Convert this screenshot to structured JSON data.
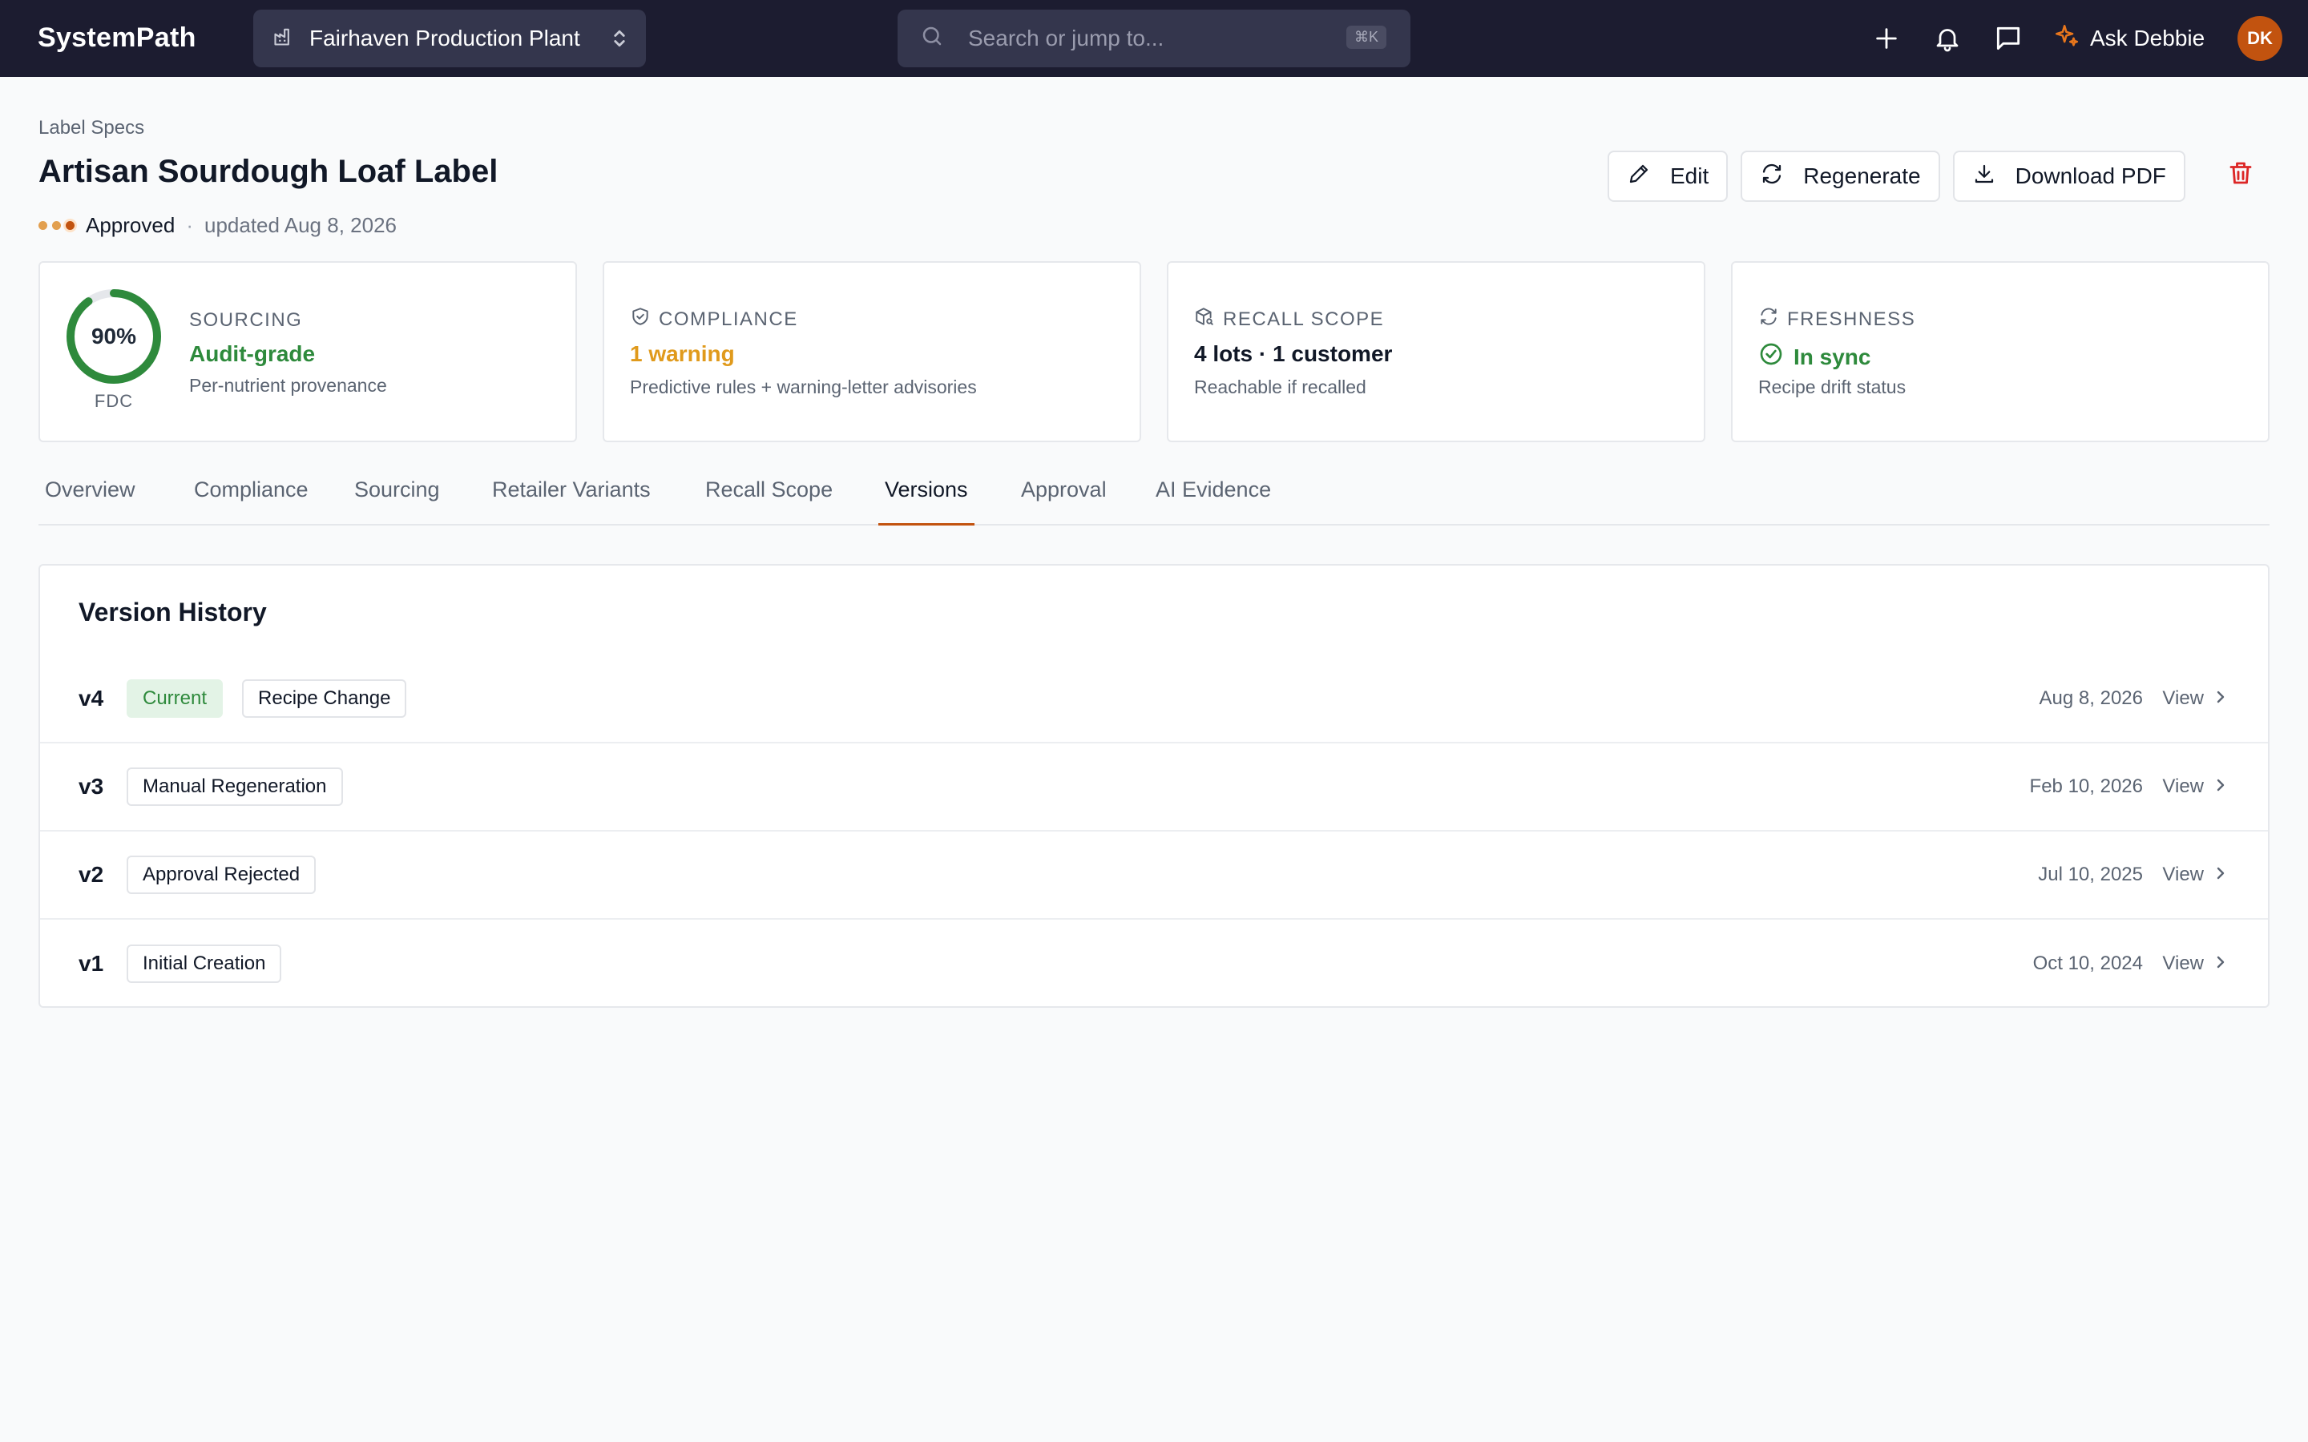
{
  "topbar": {
    "brand": "SystemPath",
    "plant": "Fairhaven Production Plant",
    "search_placeholder": "Search or jump to...",
    "search_shortcut": "⌘K",
    "ask_label": "Ask Debbie",
    "avatar_initials": "DK"
  },
  "header": {
    "breadcrumb": "Label Specs",
    "title": "Artisan Sourdough Loaf Label",
    "status": "Approved",
    "separator": "·",
    "updated": "updated Aug 8, 2026",
    "edit_label": "Edit",
    "regenerate_label": "Regenerate",
    "download_label": "Download PDF"
  },
  "cards": {
    "sourcing": {
      "percent": "90%",
      "percent_value": 0.9,
      "ring_label": "FDC",
      "label": "SOURCING",
      "value": "Audit-grade",
      "sub": "Per-nutrient provenance"
    },
    "compliance": {
      "label": "COMPLIANCE",
      "value": "1 warning",
      "sub": "Predictive rules + warning-letter advisories"
    },
    "recall": {
      "label": "RECALL SCOPE",
      "value": "4 lots · 1 customer",
      "sub": "Reachable if recalled"
    },
    "freshness": {
      "label": "FRESHNESS",
      "value": "In sync",
      "sub": "Recipe drift status"
    }
  },
  "tabs": [
    {
      "label": "Overview"
    },
    {
      "label": "Compliance"
    },
    {
      "label": "Sourcing"
    },
    {
      "label": "Retailer Variants"
    },
    {
      "label": "Recall Scope"
    },
    {
      "label": "Versions"
    },
    {
      "label": "Approval"
    },
    {
      "label": "AI Evidence"
    }
  ],
  "active_tab": "Versions",
  "versions": {
    "title": "Version History",
    "view_label": "View",
    "rows": [
      {
        "version": "v4",
        "current": "Current",
        "reason": "Recipe Change",
        "date": "Aug 8, 2026"
      },
      {
        "version": "v3",
        "reason": "Manual Regeneration",
        "date": "Feb 10, 2026"
      },
      {
        "version": "v2",
        "reason": "Approval Rejected",
        "date": "Jul 10, 2025"
      },
      {
        "version": "v1",
        "reason": "Initial Creation",
        "date": "Oct 10, 2024"
      }
    ]
  },
  "colors": {
    "topbar": "#1c1c30",
    "accent": "#c2530f",
    "success": "#2e8a3c",
    "warning": "#e09a1c",
    "danger": "#dc2626"
  }
}
